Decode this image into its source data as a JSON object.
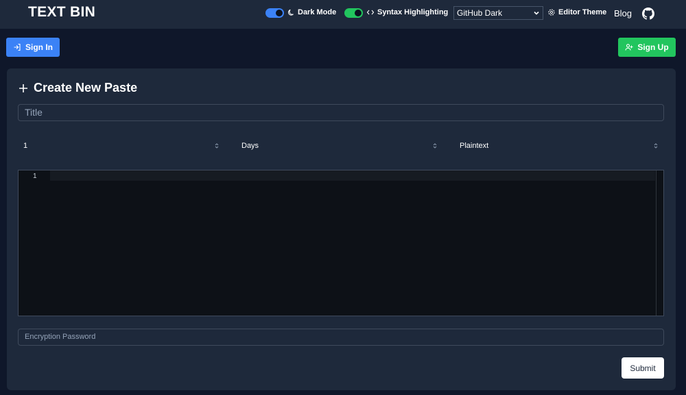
{
  "header": {
    "brand": "TEXT BIN",
    "dark_mode_label": "Dark Mode",
    "syntax_label": "Syntax Highlighting",
    "theme_selected": "GitHub Dark",
    "editor_theme_label": "Editor Theme",
    "blog_label": "Blog"
  },
  "auth": {
    "signin_label": "Sign In",
    "signup_label": "Sign Up"
  },
  "card": {
    "title": "Create New Paste",
    "title_placeholder": "Title",
    "expiry_value": "1",
    "expiry_unit": "Days",
    "language": "Plaintext",
    "line_number": "1",
    "password_placeholder": "Encryption Password",
    "submit_label": "Submit"
  },
  "colors": {
    "background": "#0f172a",
    "panel": "#1e293b",
    "primary": "#3b82f6",
    "success": "#22c55e",
    "editor_bg": "#0d1117"
  }
}
